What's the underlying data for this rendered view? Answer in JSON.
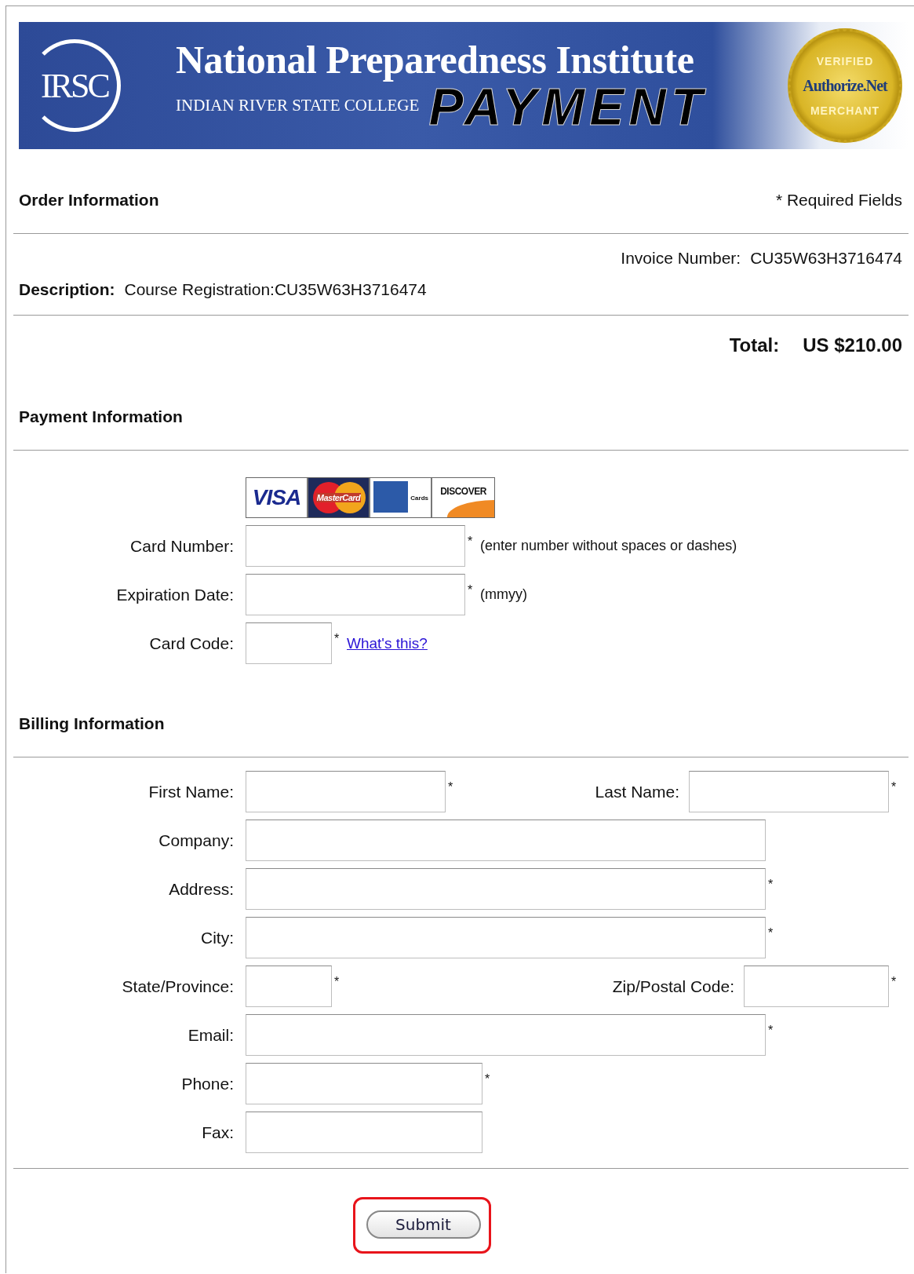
{
  "banner": {
    "logo": "IRSC",
    "title": "National Preparedness Institute",
    "subtitle": "INDIAN RIVER STATE COLLEGE",
    "word": "PAYMENT",
    "seal": {
      "top": "VERIFIED",
      "brand": "Authorize.Net",
      "bottom": "MERCHANT"
    }
  },
  "order": {
    "heading": "Order Information",
    "required_note": "* Required Fields",
    "invoice_label": "Invoice Number:",
    "invoice_value": "CU35W63H3716474",
    "description_label": "Description:",
    "description_value": "Course Registration:CU35W63H3716474",
    "total_label": "Total:",
    "total_value": "US $210.00"
  },
  "payment": {
    "heading": "Payment Information",
    "cards": [
      {
        "kind": "visa",
        "label": "VISA"
      },
      {
        "kind": "mastercard",
        "label": "MasterCard"
      },
      {
        "kind": "amex",
        "label": "Cards"
      },
      {
        "kind": "discover",
        "label": "DISCOVER"
      }
    ],
    "fields": [
      {
        "label": "Card Number:",
        "kind": "medium",
        "mark": "*",
        "note": "(enter number without spaces or dashes)"
      },
      {
        "label": "Expiration Date:",
        "kind": "medium",
        "mark": "*",
        "note": "(mmyy)"
      },
      {
        "label": "Card Code:",
        "kind": "tiny",
        "mark": "*",
        "link": "What's this?"
      }
    ]
  },
  "billing": {
    "heading": "Billing Information",
    "rows": [
      [
        {
          "label": "First Name:",
          "kind": "name",
          "mark": "*"
        },
        {
          "label": "Last Name:",
          "kind": "name",
          "mark": "*"
        }
      ],
      [
        {
          "label": "Company:",
          "kind": "long"
        }
      ],
      [
        {
          "label": "Address:",
          "kind": "long",
          "mark": "*"
        }
      ],
      [
        {
          "label": "City:",
          "kind": "long",
          "mark": "*"
        }
      ],
      [
        {
          "label": "State/Province:",
          "kind": "tiny",
          "mark": "*"
        },
        {
          "label": "Zip/Postal Code:",
          "kind": "zip",
          "mark": "*"
        }
      ],
      [
        {
          "label": "Email:",
          "kind": "long",
          "mark": "*"
        }
      ],
      [
        {
          "label": "Phone:",
          "kind": "phone",
          "mark": "*"
        }
      ],
      [
        {
          "label": "Fax:",
          "kind": "phone"
        }
      ]
    ]
  },
  "submit": {
    "label": "Submit",
    "highlighted": true
  }
}
